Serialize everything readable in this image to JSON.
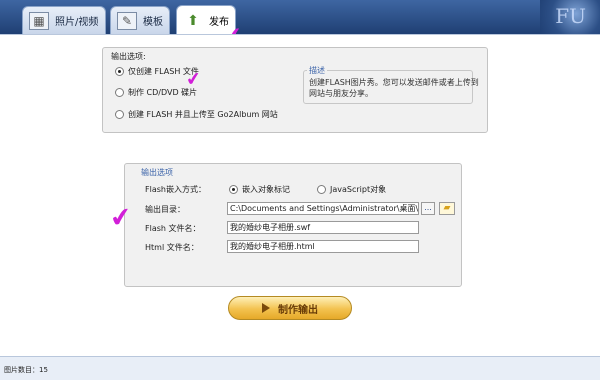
{
  "tabs": [
    {
      "label": "照片/视频",
      "icon": "photo-grid-icon"
    },
    {
      "label": "模板",
      "icon": "template-tools-icon"
    },
    {
      "label": "发布",
      "icon": "publish-upload-icon"
    }
  ],
  "header_deco": "FU",
  "top_panel": {
    "title": "输出选项:",
    "options": [
      {
        "label": "仅创建 FLASH 文件",
        "selected": true
      },
      {
        "label": "制作 CD/DVD 碟片",
        "selected": false
      },
      {
        "label": "创建 FLASH 并且上传至 Go2Album 网站",
        "selected": false
      }
    ],
    "description": {
      "title": "描述",
      "line1": "创建FLASH图片秀。您可以发送邮件或者上传到",
      "line2": "网站与朋友分享。"
    }
  },
  "output_panel": {
    "title": "输出选项",
    "embed_label": "Flash嵌入方式：",
    "embed_options": [
      {
        "label": "嵌入对象标记",
        "selected": true
      },
      {
        "label": "JavaScript对象",
        "selected": false
      }
    ],
    "dir_label": "输出目录：",
    "dir_value": "C:\\Documents and Settings\\Administrator\\桌面\\flash电子相册制",
    "browse_label": "...",
    "flash_label": "Flash 文件名：",
    "flash_value": "我的婚纱电子相册.swf",
    "html_label": "Html 文件名：",
    "html_value": "我的婚纱电子相册.html"
  },
  "action_button": "制作输出",
  "status": "图片数目：15",
  "colors": {
    "accent": "#3a62a8",
    "annotation": "#d21fd8",
    "button": "#f3c24f"
  }
}
